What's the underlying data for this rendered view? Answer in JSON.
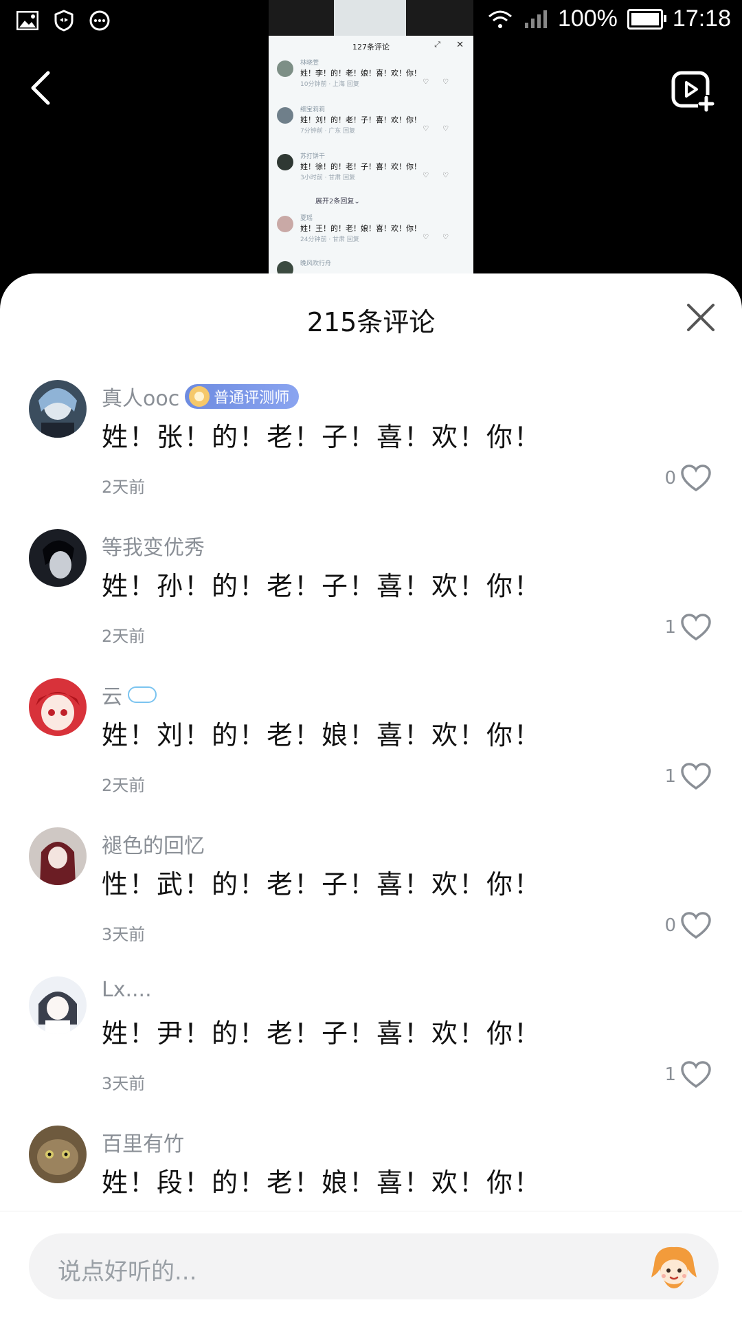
{
  "status": {
    "battery": "100%",
    "time": "17:18"
  },
  "preview": {
    "title": "127条评论",
    "comments": [
      {
        "name": "林晓萱",
        "text": "姓！李！的！老！娘！喜！欢！你！",
        "meta": "10分钟前 · 上海    回复"
      },
      {
        "name": "细宝莉莉",
        "text": "姓！刘！的！老！子！喜！欢！你！",
        "meta": "7分钟前 · 广东    回复"
      },
      {
        "name": "苏打饼干",
        "text": "姓！徐！的！老！子！喜！欢！你！",
        "meta": "3小时前 · 甘肃    回复"
      },
      {
        "name": "夏瑶",
        "text": "姓！王！的！老！娘！喜！欢！你！",
        "meta": "24分钟前 · 甘肃    回复"
      }
    ],
    "expand_replies": "展开2条回复⌄",
    "last_name": "晚风吹行舟"
  },
  "sheet": {
    "title": "215条评论",
    "comments": [
      {
        "name": "真人ooc",
        "badge": "普通评测师",
        "text": "姓！张！的！老！子！喜！欢！你！",
        "time": "2天前",
        "likes": "0",
        "avatar_color": "#3b4d5e"
      },
      {
        "name": "等我变优秀",
        "text": "姓！孙！的！老！子！喜！欢！你！",
        "time": "2天前",
        "likes": "1",
        "avatar_color": "#1a1d24"
      },
      {
        "name": "云",
        "text": "姓！刘！的！老！娘！喜！欢！你！",
        "time": "2天前",
        "likes": "1",
        "avatar_color": "#d8323a"
      },
      {
        "name": "褪色的回忆",
        "text": "性！武！的！老！子！喜！欢！你！",
        "time": "3天前",
        "likes": "0",
        "avatar_color": "#6b1d24"
      },
      {
        "name": "Lx....",
        "text": "姓！尹！的！老！子！喜！欢！你！",
        "time": "3天前",
        "likes": "1",
        "avatar_color": "#dfe5ee"
      },
      {
        "name": "百里有竹",
        "text": "姓！段！的！老！娘！喜！欢！你！",
        "time": "",
        "likes": "",
        "avatar_color": "#6e5a3e"
      }
    ]
  },
  "input": {
    "placeholder": "说点好听的..."
  }
}
